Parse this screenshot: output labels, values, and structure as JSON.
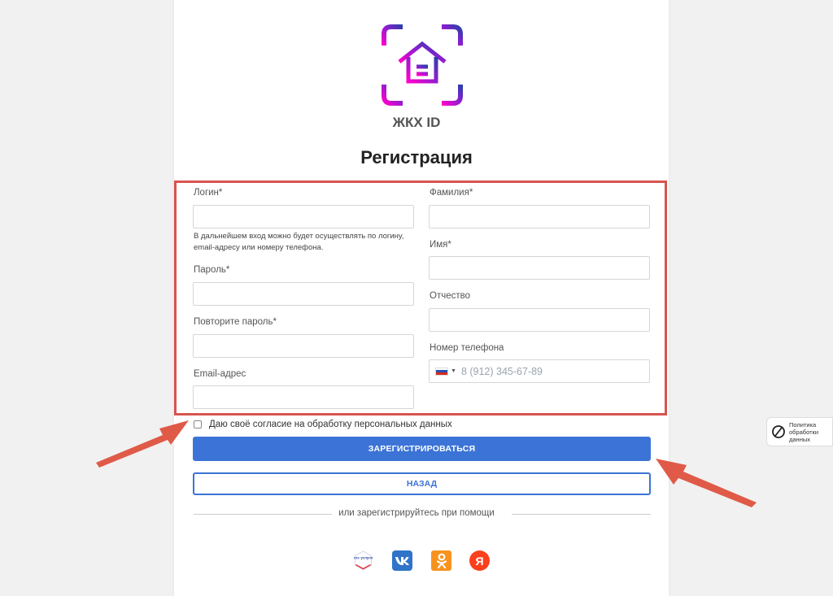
{
  "brand": {
    "name": "ЖКХ ID"
  },
  "page": {
    "title": "Регистрация"
  },
  "form": {
    "login_label": "Логин*",
    "login_hint": "В дальнейшем вход можно будет осуществлять по логину, email-адресу или номеру телефона.",
    "password_label": "Пароль*",
    "repeat_password_label": "Повторите пароль*",
    "email_label": "Email-адрес",
    "last_name_label": "Фамилия*",
    "first_name_label": "Имя*",
    "middle_name_label": "Отчество",
    "phone_label": "Номер телефона",
    "phone_placeholder": "8 (912) 345-67-89",
    "consent_label": "Даю своё согласие на обработку персональных данных"
  },
  "buttons": {
    "register": "ЗАРЕГИСТРИРОВАТЬСЯ",
    "back": "НАЗАД"
  },
  "divider": {
    "text": "или зарегистрируйтесь при помощи"
  },
  "social": {
    "gosuslugi": "гос услуги",
    "vk": "VK",
    "ok": "OK",
    "yandex": "Я"
  },
  "side_widget": {
    "label": "Политика обработки данных"
  },
  "colors": {
    "accent": "#3b74d6",
    "highlight": "#d9534f",
    "logo_gradient": [
      "#ff00cc",
      "#5a2fc2",
      "#2a3fa8"
    ]
  }
}
